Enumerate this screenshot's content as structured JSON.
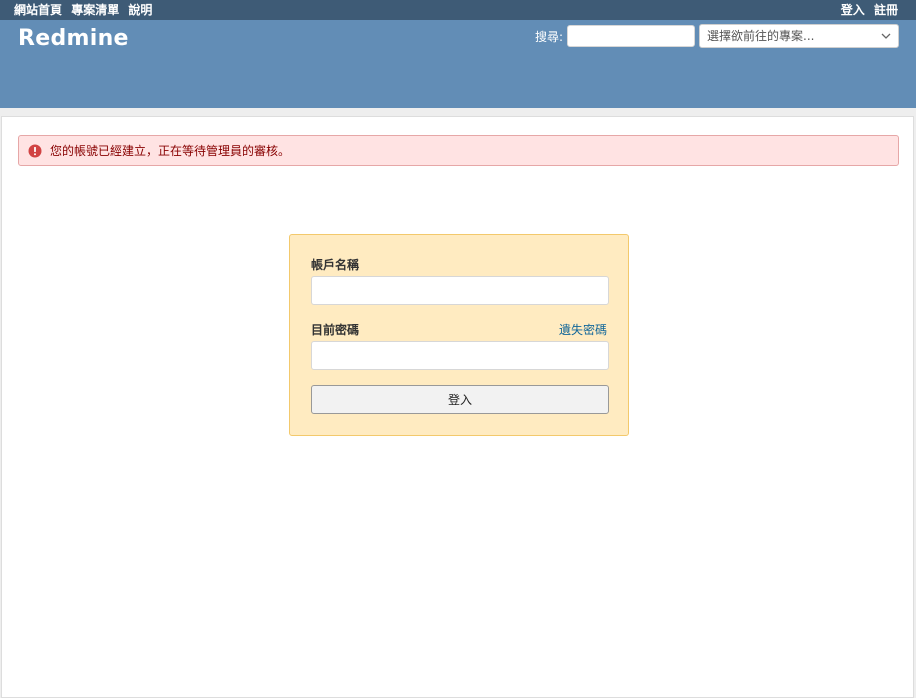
{
  "top_menu": {
    "left_items": [
      "網站首頁",
      "專案清單",
      "說明"
    ],
    "right_items": [
      "登入",
      "註冊"
    ]
  },
  "header": {
    "title": "Redmine",
    "search_label": "搜尋:",
    "search_value": "",
    "project_jump_label": "選擇欲前往的專案..."
  },
  "flash": {
    "type": "error",
    "icon": "error-circle-icon",
    "message": "您的帳號已經建立，正在等待管理員的審核。"
  },
  "login": {
    "username_label": "帳戶名稱",
    "username_value": "",
    "password_label": "目前密碼",
    "password_value": "",
    "lost_password_link": "遺失密碼",
    "submit_label": "登入"
  },
  "colors": {
    "top_menu_bg": "#3e5b76",
    "header_bg": "#628db6",
    "flash_bg": "#ffe3e3",
    "login_bg": "#ffebc1",
    "link": "#116699"
  }
}
